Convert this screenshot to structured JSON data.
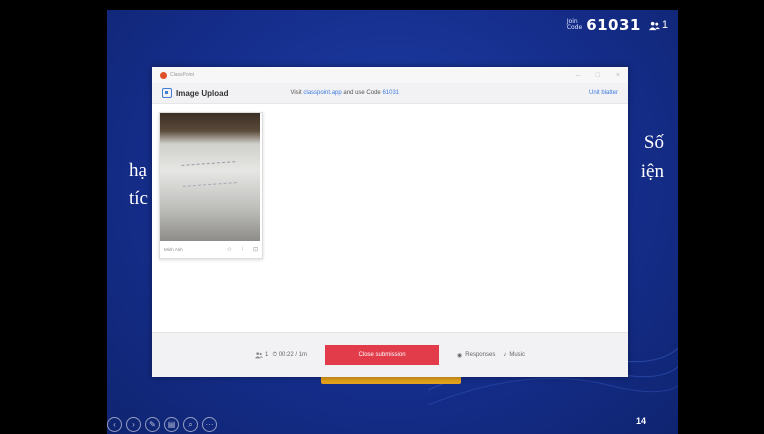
{
  "session": {
    "code_label_top": "Join",
    "code_label_bottom": "Code",
    "code": "61031",
    "participants": "1"
  },
  "slide": {
    "text_right_1": "Số",
    "text_left_1": "hạ",
    "text_right_2": "iện",
    "text_left_2": "tíc",
    "page_number": "14"
  },
  "window": {
    "app_name": "ClassPoint",
    "controls": [
      "–",
      "□",
      "×"
    ],
    "title": "Image Upload",
    "instruction_prefix": "Visit",
    "instruction_link": "classpoint.app",
    "instruction_middle": "and use Code",
    "instruction_code": "61031",
    "header_action": "Unit blatter"
  },
  "submissions": [
    {
      "name": "Minh Anh",
      "icons": [
        "☆",
        "↓",
        "⊡"
      ]
    }
  ],
  "footer": {
    "count": "1",
    "timer": "00:22 / 1m",
    "close_button": "Close submission",
    "responses": "Responses",
    "music": "Music"
  },
  "toolbar": [
    "‹",
    "›",
    "✎",
    "▤",
    "⌕",
    "···"
  ],
  "colors": {
    "slide_bg": "#152e8c",
    "close_button": "#e23c4a",
    "link": "#3d7be0",
    "accent_bar": "#e6a21b"
  }
}
